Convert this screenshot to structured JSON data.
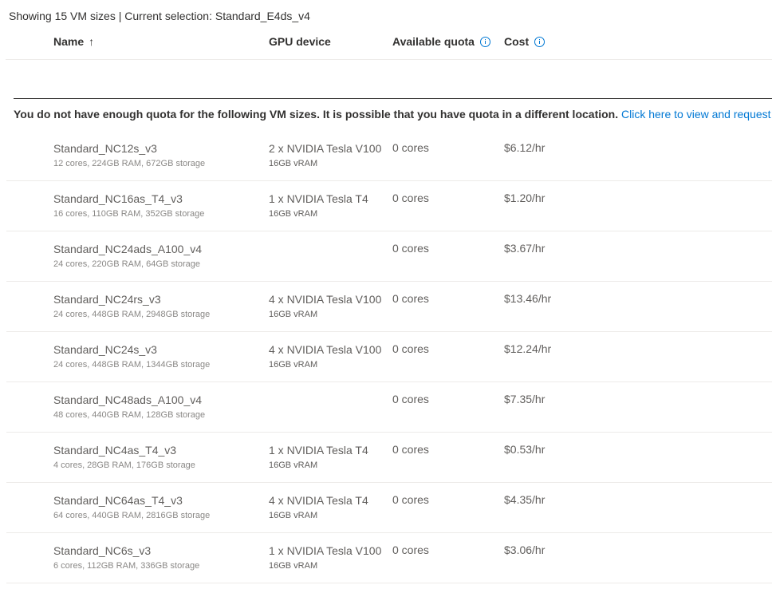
{
  "summary": {
    "text": "Showing 15 VM sizes | Current selection: Standard_E4ds_v4"
  },
  "columns": {
    "name": "Name",
    "name_sort_arrow": "↑",
    "gpu": "GPU device",
    "quota": "Available quota",
    "cost": "Cost"
  },
  "banner": {
    "message": "You do not have enough quota for the following VM sizes. It is possible that you have quota in a different location.",
    "link": "Click here to view and request quota"
  },
  "rows": [
    {
      "name": "Standard_NC12s_v3",
      "specs": "12 cores, 224GB RAM, 672GB storage",
      "gpu": "2 x NVIDIA Tesla V100",
      "vram": "16GB vRAM",
      "quota": "0 cores",
      "cost": "$6.12/hr"
    },
    {
      "name": "Standard_NC16as_T4_v3",
      "specs": "16 cores, 110GB RAM, 352GB storage",
      "gpu": "1 x NVIDIA Tesla T4",
      "vram": "16GB vRAM",
      "quota": "0 cores",
      "cost": "$1.20/hr"
    },
    {
      "name": "Standard_NC24ads_A100_v4",
      "specs": "24 cores, 220GB RAM, 64GB storage",
      "gpu": "",
      "vram": "",
      "quota": "0 cores",
      "cost": "$3.67/hr"
    },
    {
      "name": "Standard_NC24rs_v3",
      "specs": "24 cores, 448GB RAM, 2948GB storage",
      "gpu": "4 x NVIDIA Tesla V100",
      "vram": "16GB vRAM",
      "quota": "0 cores",
      "cost": "$13.46/hr"
    },
    {
      "name": "Standard_NC24s_v3",
      "specs": "24 cores, 448GB RAM, 1344GB storage",
      "gpu": "4 x NVIDIA Tesla V100",
      "vram": "16GB vRAM",
      "quota": "0 cores",
      "cost": "$12.24/hr"
    },
    {
      "name": "Standard_NC48ads_A100_v4",
      "specs": "48 cores, 440GB RAM, 128GB storage",
      "gpu": "",
      "vram": "",
      "quota": "0 cores",
      "cost": "$7.35/hr"
    },
    {
      "name": "Standard_NC4as_T4_v3",
      "specs": "4 cores, 28GB RAM, 176GB storage",
      "gpu": "1 x NVIDIA Tesla T4",
      "vram": "16GB vRAM",
      "quota": "0 cores",
      "cost": "$0.53/hr"
    },
    {
      "name": "Standard_NC64as_T4_v3",
      "specs": "64 cores, 440GB RAM, 2816GB storage",
      "gpu": "4 x NVIDIA Tesla T4",
      "vram": "16GB vRAM",
      "quota": "0 cores",
      "cost": "$4.35/hr"
    },
    {
      "name": "Standard_NC6s_v3",
      "specs": "6 cores, 112GB RAM, 336GB storage",
      "gpu": "1 x NVIDIA Tesla V100",
      "vram": "16GB vRAM",
      "quota": "0 cores",
      "cost": "$3.06/hr"
    }
  ],
  "colors": {
    "accent": "#0078d4",
    "text": "#323130",
    "muted_text": "#605e5c",
    "row_divider": "#edebe9"
  },
  "icons": {
    "sort": "arrow-up-icon",
    "info": "info-icon"
  }
}
